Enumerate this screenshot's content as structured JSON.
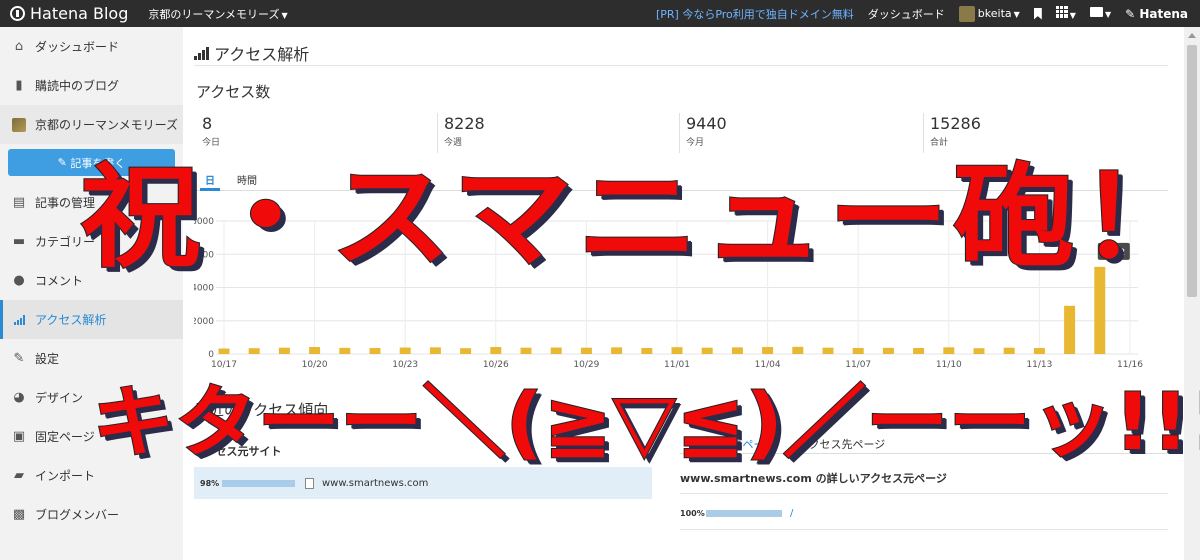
{
  "topbar": {
    "logo": "Hatena Blog",
    "blog_name": "京都のリーマンメモリーズ",
    "pr_link": "[PR] 今ならPro利用で独自ドメイン無料",
    "dashboard": "ダッシュボード",
    "user": "bkeita",
    "brand": "Hatena"
  },
  "sidebar": {
    "items": [
      {
        "label": "ダッシュボード",
        "icon": "home-icon"
      },
      {
        "label": "購読中のブログ",
        "icon": "bookmark-icon"
      },
      {
        "label": "京都のリーマンメモリーズ",
        "icon": "blog-thumbnail"
      },
      {
        "label": "記事の管理",
        "icon": "document-icon"
      },
      {
        "label": "カテゴリー",
        "icon": "folder-icon"
      },
      {
        "label": "コメント",
        "icon": "comment-icon"
      },
      {
        "label": "アクセス解析",
        "icon": "bar-chart-icon"
      },
      {
        "label": "設定",
        "icon": "wrench-icon"
      },
      {
        "label": "デザイン",
        "icon": "palette-icon"
      },
      {
        "label": "固定ページ",
        "icon": "page-icon"
      },
      {
        "label": "インポート",
        "icon": "truck-icon"
      },
      {
        "label": "ブログメンバー",
        "icon": "member-icon"
      }
    ],
    "write_button": "記事を書く"
  },
  "main": {
    "page_title": "アクセス解析",
    "section_title": "アクセス数",
    "stats": [
      {
        "value": "8",
        "label": "今日"
      },
      {
        "value": "8228",
        "label": "今週"
      },
      {
        "value": "9440",
        "label": "今月"
      },
      {
        "value": "15286",
        "label": "合計"
      }
    ],
    "tabs": [
      "日",
      "時間"
    ],
    "trend_title": "最近のアクセス傾向",
    "source_tabs": [
      "アクセス元ページ",
      "アクセス先ページ"
    ],
    "source_site_title": "アクセス元サイト",
    "source_site": {
      "percent": "98%",
      "fill": 0.98,
      "domain": "www.smartnews.com"
    },
    "detail_title": "www.smartnews.com の詳しいアクセス元ページ",
    "detail_row": {
      "percent": "100%",
      "fill": 1.0,
      "path": "/"
    }
  },
  "chart_data": {
    "type": "bar",
    "color": "#e8b833",
    "categories": [
      "10/17",
      "10/18",
      "10/19",
      "10/20",
      "10/21",
      "10/22",
      "10/23",
      "10/24",
      "10/25",
      "10/26",
      "10/27",
      "10/28",
      "10/29",
      "10/30",
      "10/31",
      "11/01",
      "11/02",
      "11/03",
      "11/04",
      "11/05",
      "11/06",
      "11/07",
      "11/08",
      "11/09",
      "11/10",
      "11/11",
      "11/12",
      "11/13",
      "11/14",
      "11/15",
      "11/16"
    ],
    "tick_labels": [
      "10/17",
      "10/20",
      "10/23",
      "10/26",
      "10/29",
      "11/01",
      "11/04",
      "11/07",
      "11/10",
      "11/13",
      "11/16"
    ],
    "values": [
      330,
      350,
      380,
      420,
      370,
      360,
      390,
      400,
      350,
      420,
      380,
      390,
      380,
      400,
      360,
      410,
      380,
      400,
      420,
      430,
      380,
      360,
      370,
      360,
      400,
      350,
      380,
      360,
      2900,
      5242,
      0
    ],
    "ylim": [
      0,
      8000
    ],
    "yticks": [
      0,
      2000,
      4000,
      6000,
      8000
    ],
    "tooltip": "5242",
    "grid": true
  },
  "overlay": {
    "line1": "祝・スマニュー砲！",
    "line2": "キターー＼(≧▽≦)／ーーッ!!!"
  }
}
